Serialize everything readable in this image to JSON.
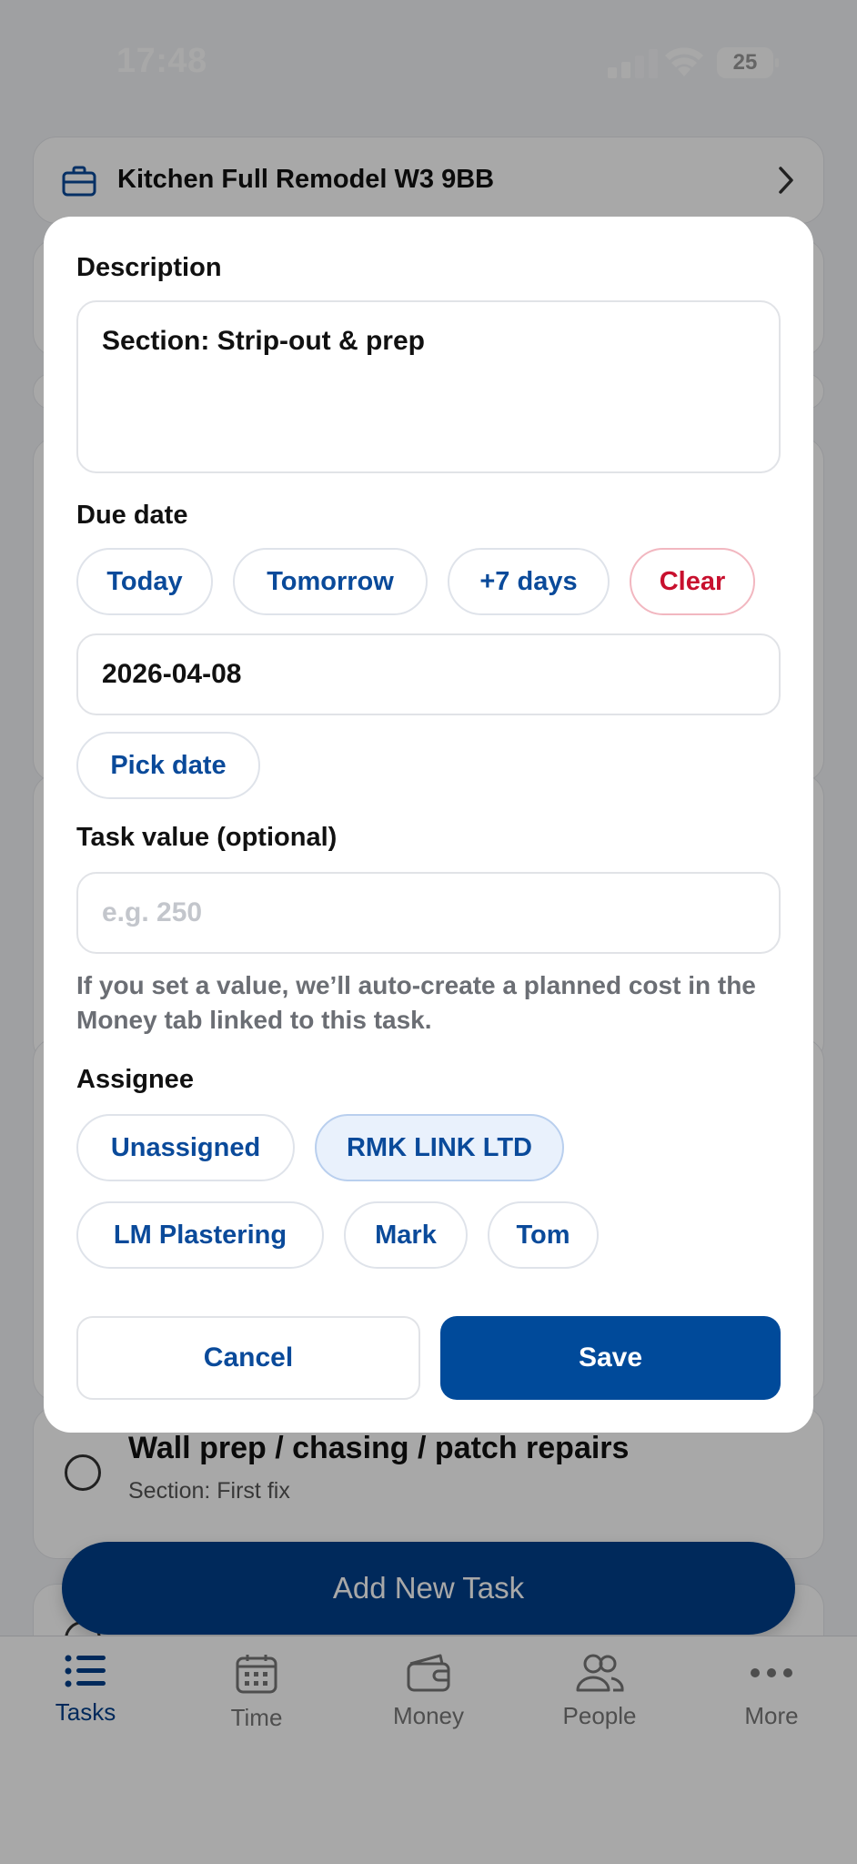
{
  "status_bar": {
    "time": "17:48",
    "battery": "25"
  },
  "project": {
    "title": "Kitchen Full Remodel W3 9BB"
  },
  "background_task": {
    "title": "Wall prep / chasing / patch repairs",
    "section": "Section: First fix"
  },
  "add_task_label": "Add New Task",
  "tabs": [
    {
      "label": "Tasks",
      "icon": "list-icon",
      "active": true
    },
    {
      "label": "Time",
      "icon": "calendar-icon"
    },
    {
      "label": "Money",
      "icon": "wallet-icon"
    },
    {
      "label": "People",
      "icon": "people-icon"
    },
    {
      "label": "More",
      "icon": "more-icon"
    }
  ],
  "modal": {
    "description_label": "Description",
    "description_value": "Section: Strip-out & prep",
    "due_date_label": "Due date",
    "quick_dates": [
      "Today",
      "Tomorrow",
      "+7 days",
      "Clear"
    ],
    "due_date_value": "2026-04-08",
    "pick_date_label": "Pick date",
    "task_value_label": "Task value (optional)",
    "task_value_placeholder": "e.g. 250",
    "task_value_hint": "If you set a value, we’ll auto-create a planned cost in the Money tab linked to this task.",
    "assignee_label": "Assignee",
    "assignees": [
      "Unassigned",
      "RMK LINK LTD",
      "LM Plastering",
      "Mark",
      "Tom"
    ],
    "selected_assignee": "RMK LINK LTD",
    "cancel_label": "Cancel",
    "save_label": "Save"
  },
  "colors": {
    "primary": "#004a9a",
    "danger": "#c8102e",
    "selected_chip": "#e9f1fc"
  }
}
